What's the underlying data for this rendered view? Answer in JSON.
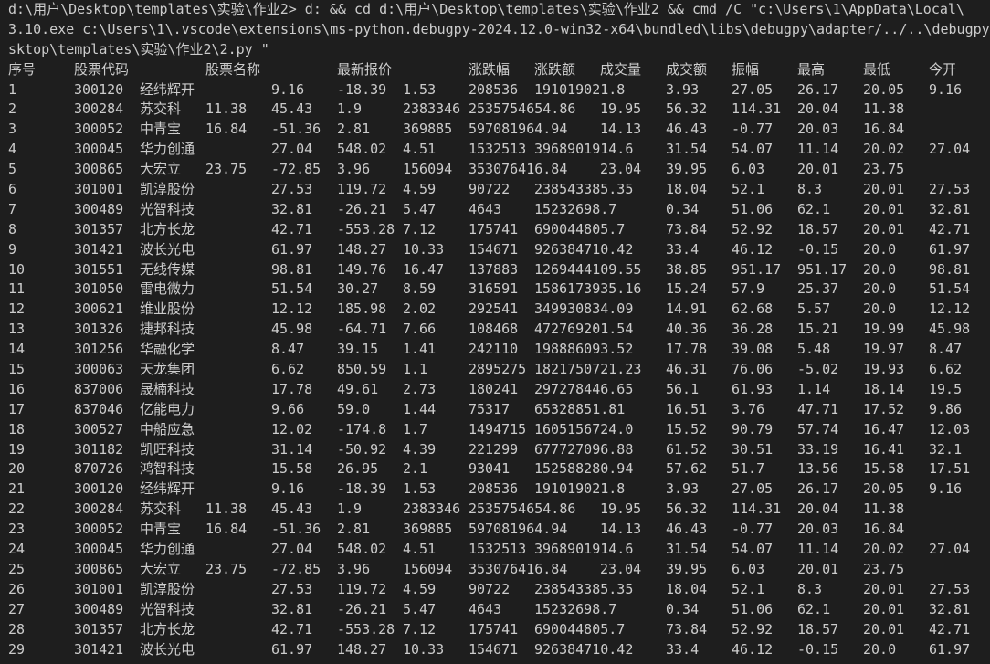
{
  "terminal": {
    "command_lines": [
      "d:\\用户\\Desktop\\templates\\实验\\作业2> d: && cd d:\\用户\\Desktop\\templates\\实验\\作业2 && cmd /C \"c:\\Users\\1\\AppData\\Local\\",
      "3.10.exe c:\\Users\\1\\.vscode\\extensions\\ms-python.debugpy-2024.12.0-win32-x64\\bundled\\libs\\debugpy\\adapter/../..\\debugpy\\",
      "sktop\\templates\\实验\\作业2\\2.py \""
    ],
    "header": [
      "序号",
      "股票代码",
      "股票名称",
      "最新报价",
      "涨跌幅",
      "涨跌额",
      "成交量",
      "成交额",
      "振幅",
      "最高",
      "最低",
      "今开"
    ],
    "rows": [
      [
        "1",
        "300120",
        "经纬辉开",
        "9.16",
        "-18.39",
        "1.53",
        "208536",
        "191019021.8",
        "3.93",
        "27.05",
        "26.17",
        "20.05",
        "9.16"
      ],
      [
        "2",
        "300284",
        "苏交科",
        "11.38",
        "45.43",
        "1.9",
        "2383346",
        "2535754654.86",
        "19.95",
        "56.32",
        "114.31",
        "20.04",
        "11.38"
      ],
      [
        "3",
        "300052",
        "中青宝",
        "16.84",
        "-51.36",
        "2.81",
        "369885",
        "597081964.94",
        "14.13",
        "46.43",
        "-0.77",
        "20.03",
        "16.84"
      ],
      [
        "4",
        "300045",
        "华力创通",
        "27.04",
        "548.02",
        "4.51",
        "1532513",
        "3968901914.6",
        "31.54",
        "54.07",
        "11.14",
        "20.02",
        "27.04"
      ],
      [
        "5",
        "300865",
        "大宏立",
        "23.75",
        "-72.85",
        "3.96",
        "156094",
        "353076416.84",
        "23.04",
        "39.95",
        "6.03",
        "20.01",
        "23.75"
      ],
      [
        "6",
        "301001",
        "凯淳股份",
        "27.53",
        "119.72",
        "4.59",
        "90722",
        "238543385.35",
        "18.04",
        "52.1",
        "8.3",
        "20.01",
        "27.53"
      ],
      [
        "7",
        "300489",
        "光智科技",
        "32.81",
        "-26.21",
        "5.47",
        "4643",
        "15232698.7",
        "0.34",
        "51.06",
        "62.1",
        "20.01",
        "32.81"
      ],
      [
        "8",
        "301357",
        "北方长龙",
        "42.71",
        "-553.28",
        "7.12",
        "175741",
        "690044805.7",
        "73.84",
        "52.92",
        "18.57",
        "20.01",
        "42.71"
      ],
      [
        "9",
        "301421",
        "波长光电",
        "61.97",
        "148.27",
        "10.33",
        "154671",
        "926384710.42",
        "33.4",
        "46.12",
        "-0.15",
        "20.0",
        "61.97"
      ],
      [
        "10",
        "301551",
        "无线传媒",
        "98.81",
        "149.76",
        "16.47",
        "137883",
        "1269444109.55",
        "38.85",
        "951.17",
        "951.17",
        "20.0",
        "98.81"
      ],
      [
        "11",
        "301050",
        "雷电微力",
        "51.54",
        "30.27",
        "8.59",
        "316591",
        "1586173935.16",
        "15.24",
        "57.9",
        "25.37",
        "20.0",
        "51.54"
      ],
      [
        "12",
        "300621",
        "维业股份",
        "12.12",
        "185.98",
        "2.02",
        "292541",
        "349930834.09",
        "14.91",
        "62.68",
        "5.57",
        "20.0",
        "12.12"
      ],
      [
        "13",
        "301326",
        "捷邦科技",
        "45.98",
        "-64.71",
        "7.66",
        "108468",
        "472769201.54",
        "40.36",
        "36.28",
        "15.21",
        "19.99",
        "45.98"
      ],
      [
        "14",
        "301256",
        "华融化学",
        "8.47",
        "39.15",
        "1.41",
        "242110",
        "198886093.52",
        "17.78",
        "39.08",
        "5.48",
        "19.97",
        "8.47"
      ],
      [
        "15",
        "300063",
        "天龙集团",
        "6.62",
        "850.59",
        "1.1",
        "2895275",
        "1821750721.23",
        "46.31",
        "76.06",
        "-5.02",
        "19.93",
        "6.62"
      ],
      [
        "16",
        "837006",
        "晟楠科技",
        "17.78",
        "49.61",
        "2.73",
        "180241",
        "297278446.65",
        "56.1",
        "61.93",
        "1.14",
        "18.14",
        "19.5"
      ],
      [
        "17",
        "837046",
        "亿能电力",
        "9.66",
        "59.0",
        "1.44",
        "75317",
        "65328851.81",
        "16.51",
        "3.76",
        "47.71",
        "17.52",
        "9.86"
      ],
      [
        "18",
        "300527",
        "中船应急",
        "12.02",
        "-174.8",
        "1.7",
        "1494715",
        "1605156724.0",
        "15.52",
        "90.79",
        "57.74",
        "16.47",
        "12.03"
      ],
      [
        "19",
        "301182",
        "凯旺科技",
        "31.14",
        "-50.92",
        "4.39",
        "221299",
        "677727096.88",
        "61.52",
        "30.51",
        "33.19",
        "16.41",
        "32.1"
      ],
      [
        "20",
        "870726",
        "鸿智科技",
        "15.58",
        "26.95",
        "2.1",
        "93041",
        "152588280.94",
        "57.62",
        "51.7",
        "13.56",
        "15.58",
        "17.51"
      ],
      [
        "21",
        "300120",
        "经纬辉开",
        "9.16",
        "-18.39",
        "1.53",
        "208536",
        "191019021.8",
        "3.93",
        "27.05",
        "26.17",
        "20.05",
        "9.16"
      ],
      [
        "22",
        "300284",
        "苏交科",
        "11.38",
        "45.43",
        "1.9",
        "2383346",
        "2535754654.86",
        "19.95",
        "56.32",
        "114.31",
        "20.04",
        "11.38"
      ],
      [
        "23",
        "300052",
        "中青宝",
        "16.84",
        "-51.36",
        "2.81",
        "369885",
        "597081964.94",
        "14.13",
        "46.43",
        "-0.77",
        "20.03",
        "16.84"
      ],
      [
        "24",
        "300045",
        "华力创通",
        "27.04",
        "548.02",
        "4.51",
        "1532513",
        "3968901914.6",
        "31.54",
        "54.07",
        "11.14",
        "20.02",
        "27.04"
      ],
      [
        "25",
        "300865",
        "大宏立",
        "23.75",
        "-72.85",
        "3.96",
        "156094",
        "353076416.84",
        "23.04",
        "39.95",
        "6.03",
        "20.01",
        "23.75"
      ],
      [
        "26",
        "301001",
        "凯淳股份",
        "27.53",
        "119.72",
        "4.59",
        "90722",
        "238543385.35",
        "18.04",
        "52.1",
        "8.3",
        "20.01",
        "27.53"
      ],
      [
        "27",
        "300489",
        "光智科技",
        "32.81",
        "-26.21",
        "5.47",
        "4643",
        "15232698.7",
        "0.34",
        "51.06",
        "62.1",
        "20.01",
        "32.81"
      ],
      [
        "28",
        "301357",
        "北方长龙",
        "42.71",
        "-553.28",
        "7.12",
        "175741",
        "690044805.7",
        "73.84",
        "52.92",
        "18.57",
        "20.01",
        "42.71"
      ],
      [
        "29",
        "301421",
        "波长光电",
        "61.97",
        "148.27",
        "10.33",
        "154671",
        "926384710.42",
        "33.4",
        "46.12",
        "-0.15",
        "20.0",
        "61.97"
      ]
    ]
  },
  "colors": {
    "background": "#1e1e1e",
    "foreground": "#cccccc"
  }
}
